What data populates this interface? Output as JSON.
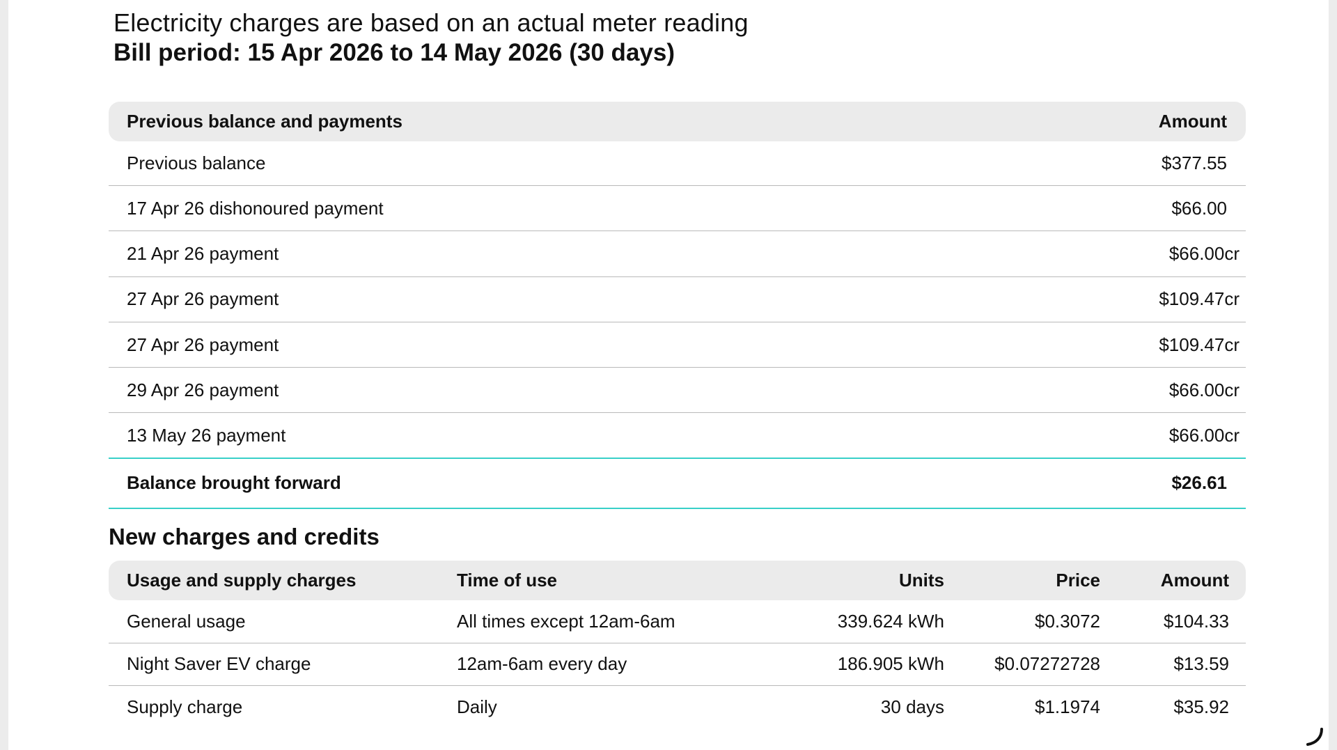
{
  "header": {
    "reading_note": "Electricity charges are based on an actual meter reading",
    "bill_period": "Bill period: 15 Apr 2026 to 14 May 2026 (30 days)"
  },
  "previous_balance_table": {
    "headers": {
      "description": "Previous balance and payments",
      "amount": "Amount"
    },
    "rows": [
      {
        "description": "Previous balance",
        "amount": "$377.55"
      },
      {
        "description": "17 Apr 26 dishonoured payment",
        "amount": "$66.00"
      },
      {
        "description": "21 Apr 26 payment",
        "amount": "$66.00cr"
      },
      {
        "description": "27 Apr 26 payment",
        "amount": "$109.47cr"
      },
      {
        "description": "27 Apr 26 payment",
        "amount": "$109.47cr"
      },
      {
        "description": "29 Apr 26 payment",
        "amount": "$66.00cr"
      },
      {
        "description": "13 May 26 payment",
        "amount": "$66.00cr"
      }
    ],
    "total": {
      "label": "Balance brought forward",
      "amount": "$26.61"
    }
  },
  "new_charges": {
    "title": "New charges and credits",
    "headers": {
      "charge": "Usage and supply charges",
      "time_of_use": "Time of use",
      "units": "Units",
      "price": "Price",
      "amount": "Amount"
    },
    "rows": [
      {
        "charge": "General usage",
        "time_of_use": "All times except 12am-6am",
        "units": "339.624 kWh",
        "price": "$0.3072",
        "amount": "$104.33"
      },
      {
        "charge": "Night Saver EV charge",
        "time_of_use": "12am-6am every day",
        "units": "186.905 kWh",
        "price": "$0.07272728",
        "amount": "$13.59"
      },
      {
        "charge": "Supply charge",
        "time_of_use": "Daily",
        "units": "30 days",
        "price": "$1.1974",
        "amount": "$35.92"
      }
    ]
  },
  "colors": {
    "accent_line": "#38d0c8",
    "header_bg": "#ebebeb",
    "divider": "#b9b9b9"
  }
}
